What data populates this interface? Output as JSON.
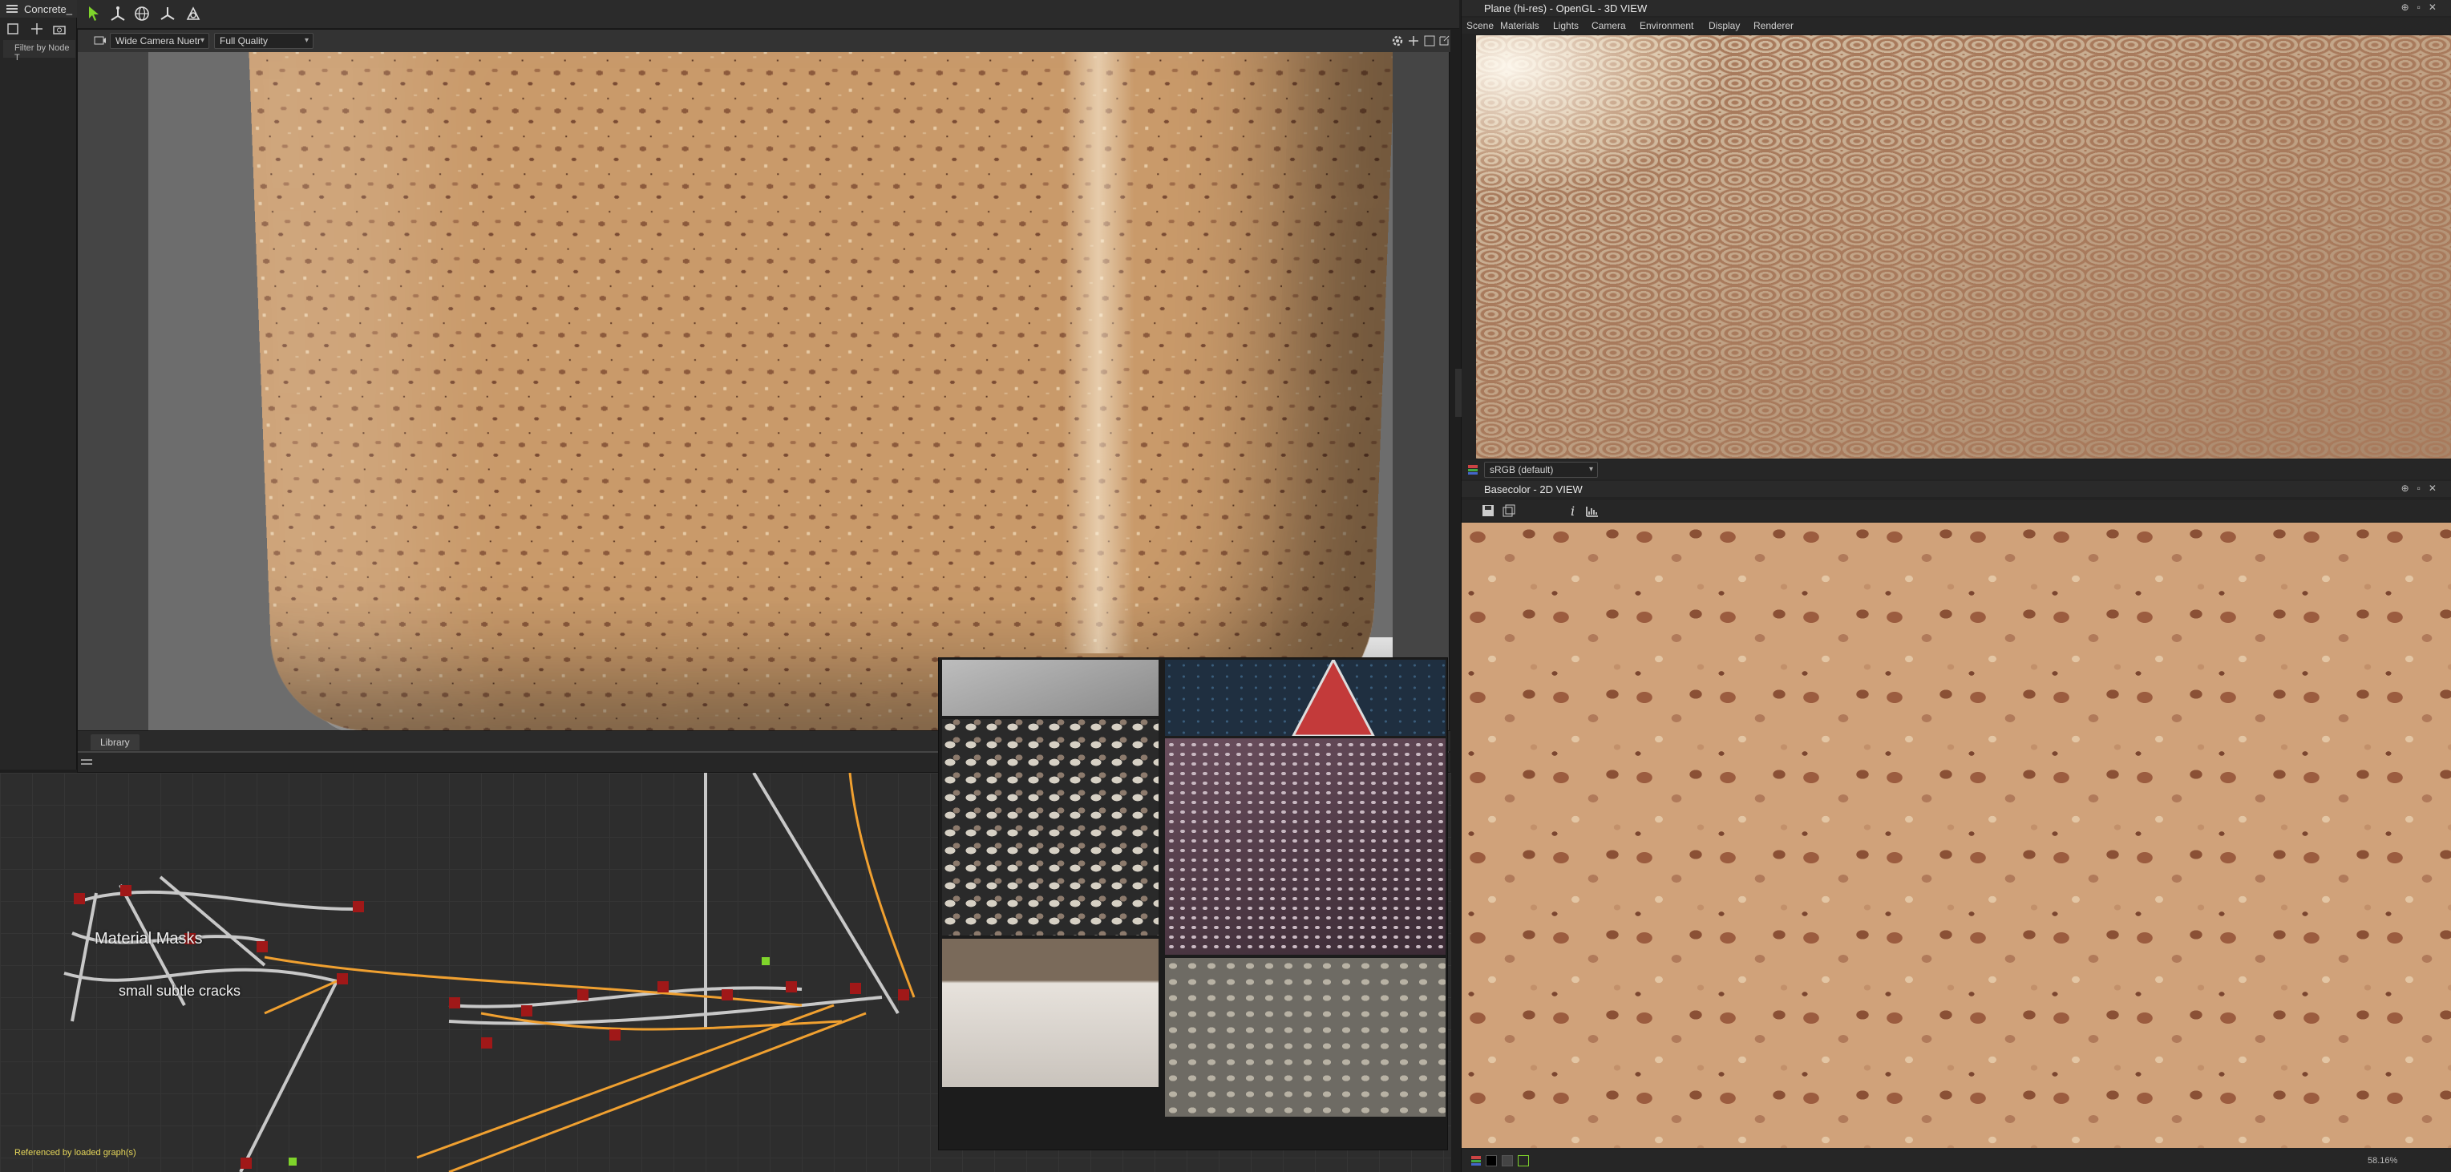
{
  "explorer": {
    "title": "Concrete_",
    "filter_label": "Filter by Node T"
  },
  "viewport": {
    "camera_label": "Wide Camera Nuetr",
    "quality_label": "Full Quality",
    "tab_library": "Library"
  },
  "graph": {
    "frame_title": "Material Masks",
    "frame_note": "small subtle cracks",
    "status_text": "Referenced by loaded graph(s)"
  },
  "panel_3d": {
    "title": "Plane (hi-res) - OpenGL - 3D VIEW",
    "menu": [
      "Scene",
      "Materials",
      "Lights",
      "Camera",
      "Environment",
      "Display",
      "Renderer"
    ],
    "colorspace": "sRGB (default)"
  },
  "panel_2d": {
    "title": "Basecolor - 2D VIEW",
    "zoom": "58.16%"
  },
  "colors": {
    "accent_green": "#7fd42b",
    "status_yellow": "#e6d65a",
    "wire_orange": "#f0a030",
    "wire_grey": "#c8c8c8",
    "node_red": "#a01818"
  },
  "icons": [
    "select-arrow-icon",
    "move-icon",
    "globe-icon",
    "axis-icon",
    "camera-icon",
    "gear-icon",
    "pin-icon",
    "close-icon",
    "save-icon",
    "info-icon",
    "histogram-icon"
  ]
}
